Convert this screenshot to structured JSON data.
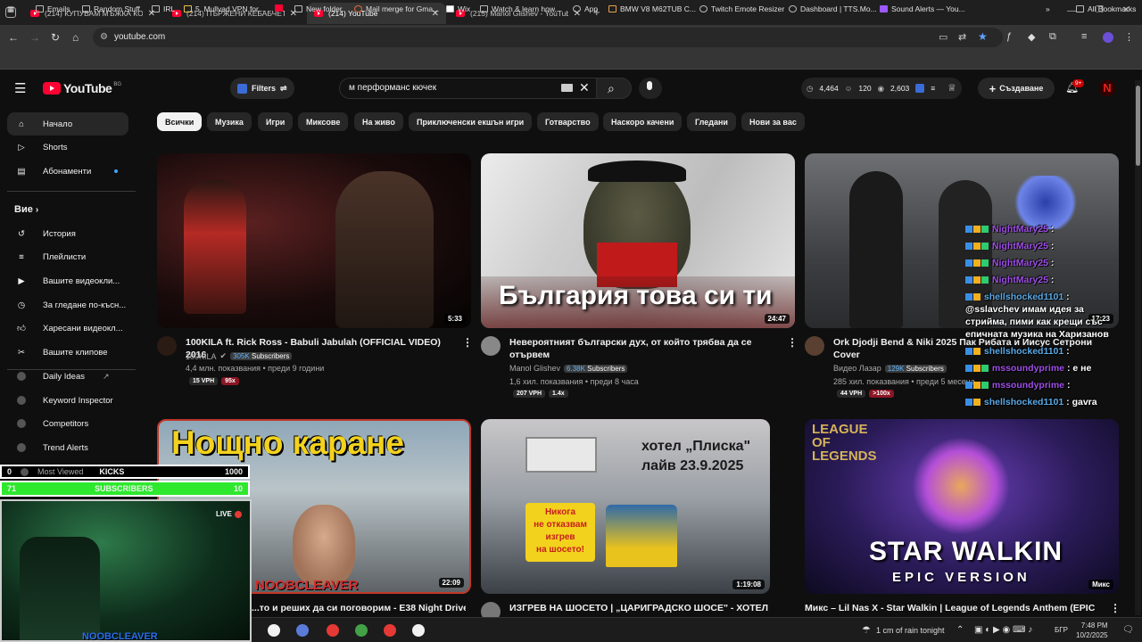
{
  "browser": {
    "tabs": [
      {
        "label": "(214) КУПУВАМ МЪЖКА КОЛА",
        "active": false
      },
      {
        "label": "(214) ПЪРЖЕНИ КЕБАБЧЕТА С",
        "active": false
      },
      {
        "label": "(214) YouTube",
        "active": true
      },
      {
        "label": "(215) Manol Glishev - YouTube",
        "active": false
      }
    ],
    "url": "youtube.com",
    "bookmarks": [
      "Emails",
      "Random Stuff",
      "IRL",
      "5. Mullvad VPN for...",
      "New folder",
      "Mail merge for Gma...",
      "Wix",
      "Watch & learn how...",
      "App",
      "BMW V8 M62TUB C...",
      "Twitch Emote Resizer",
      "Dashboard | TTS.Mo...",
      "Sound Alerts — You..."
    ],
    "all_bookmarks": "All Bookmarks"
  },
  "header": {
    "logo": "YouTube",
    "country_code": "BG",
    "filters_label": "Filters",
    "search_value": "м перформанс кючек",
    "stats": [
      "4,464",
      "120",
      "2,603"
    ],
    "create_label": "Създаване",
    "notif_count": "9+",
    "avatar_letter": "N"
  },
  "sidebar": {
    "main": [
      {
        "label": "Начало",
        "icon": "home-icon"
      },
      {
        "label": "Shorts",
        "icon": "shorts-icon"
      },
      {
        "label": "Абонаменти",
        "icon": "subscriptions-icon"
      }
    ],
    "you_heading": "Вие",
    "you": [
      {
        "label": "История",
        "icon": "history-icon"
      },
      {
        "label": "Плейлисти",
        "icon": "playlist-icon"
      },
      {
        "label": "Вашите видеокли...",
        "icon": "video-icon"
      },
      {
        "label": "За гледане по-късн...",
        "icon": "clock-icon"
      },
      {
        "label": "Харесани видеокл...",
        "icon": "like-icon"
      },
      {
        "label": "Вашите клипове",
        "icon": "scissors-icon"
      }
    ],
    "tools": [
      "Daily Ideas",
      "Keyword Inspector",
      "Competitors",
      "Trend Alerts"
    ]
  },
  "chips": [
    "Всички",
    "Музика",
    "Игри",
    "Миксове",
    "На живо",
    "Приключенски екшън игри",
    "Готварство",
    "Наскоро качени",
    "Гледани",
    "Нови за вас"
  ],
  "videos": [
    {
      "title": "100KILA ft. Rick Ross - Babuli Jabulah (OFFICIAL VIDEO) 2016",
      "channel": "100KILA",
      "subs": "305K",
      "subs_word": "Subscribers",
      "meta": "4,4 млн. показвания • преди 9 години",
      "vph": "15 VPH",
      "ratio": "95x",
      "duration": "5:33"
    },
    {
      "title": "Невероятният български дух, от който трябва да се отървем",
      "channel": "Manol Glishev",
      "subs": "6.38K",
      "subs_word": "Subscribers",
      "meta": "1,6 хил. показвания • преди 8 часа",
      "vph": "207 VPH",
      "ratio": "1.4x",
      "duration": "24:47",
      "thumb_text": "България това си ти"
    },
    {
      "title": "Ork Djodji Bend & Niki 2025 Пак Рибата и Иисус Сетрони Cover",
      "channel": "Видео Лазар",
      "subs": "129K",
      "subs_word": "Subscribers",
      "meta": "285 хил. показвания • преди 5 месеца",
      "vph": "44 VPH",
      "ratio": ">100x",
      "duration": "17:23"
    },
    {
      "title": "...то и реших да си поговорим - E38 Night Drive",
      "duration": "22:09",
      "thumb_text": "Нощно каране",
      "thumb_sub": "NOOBCLEAVER"
    },
    {
      "title": "ИЗГРЕВ НА ШОСЕТО | „ЦАРИГРАДСКО ШОСЕ\" - ХОТЕЛ",
      "duration": "1:19:08",
      "thumb_text": "хотел „Плиска\"",
      "thumb_text2": "лайв 23.9.2025",
      "thumb_sign": [
        "Никога",
        "не отказвам",
        "изгрев",
        "на шосето!"
      ]
    },
    {
      "title": "Микс – Lil Nas X - Star Walkin | League of Legends Anthem (EPIC",
      "duration": "Микс",
      "thumb_text": "STAR WALKIN",
      "thumb_text2": "EPIC VERSION",
      "thumb_logo": "LEAGUE OF LEGENDS"
    }
  ],
  "overlay": {
    "kicks_num": "0",
    "kicks_label": "Most Viewed",
    "kicks_title": "KICKS",
    "kicks_goal": "1000",
    "subs_num": "71",
    "subs_label": "SUBSCRIBERS",
    "subs_goal": "10",
    "live_label": "LIVE",
    "streamer": "NOOBCLEAVER"
  },
  "chat": [
    {
      "name": "NightMary25",
      "text": ":",
      "color": "purple"
    },
    {
      "name": "NightMary25",
      "text": ":",
      "color": "purple"
    },
    {
      "name": "NightMary25",
      "text": ":",
      "color": "purple"
    },
    {
      "name": "NightMary25",
      "text": ":",
      "color": "purple"
    },
    {
      "name": "shellshocked1101",
      "text": ": @sslavchev имам идея за стрийма, пими как крещи със епичната музика на Харизанов",
      "color": "cyan"
    },
    {
      "name": "shellshocked1101",
      "text": ":",
      "color": "cyan"
    },
    {
      "name": "mssoundyprime",
      "text": ": е не",
      "color": "purple"
    },
    {
      "name": "mssoundyprime",
      "text": ":",
      "color": "purple"
    },
    {
      "name": "shellshocked1101",
      "text": ": gavra",
      "color": "cyan"
    }
  ],
  "taskbar": {
    "weather": "1 cm of rain tonight",
    "lang": "БГР",
    "time": "7:48 PM",
    "date": "10/2/2025"
  }
}
